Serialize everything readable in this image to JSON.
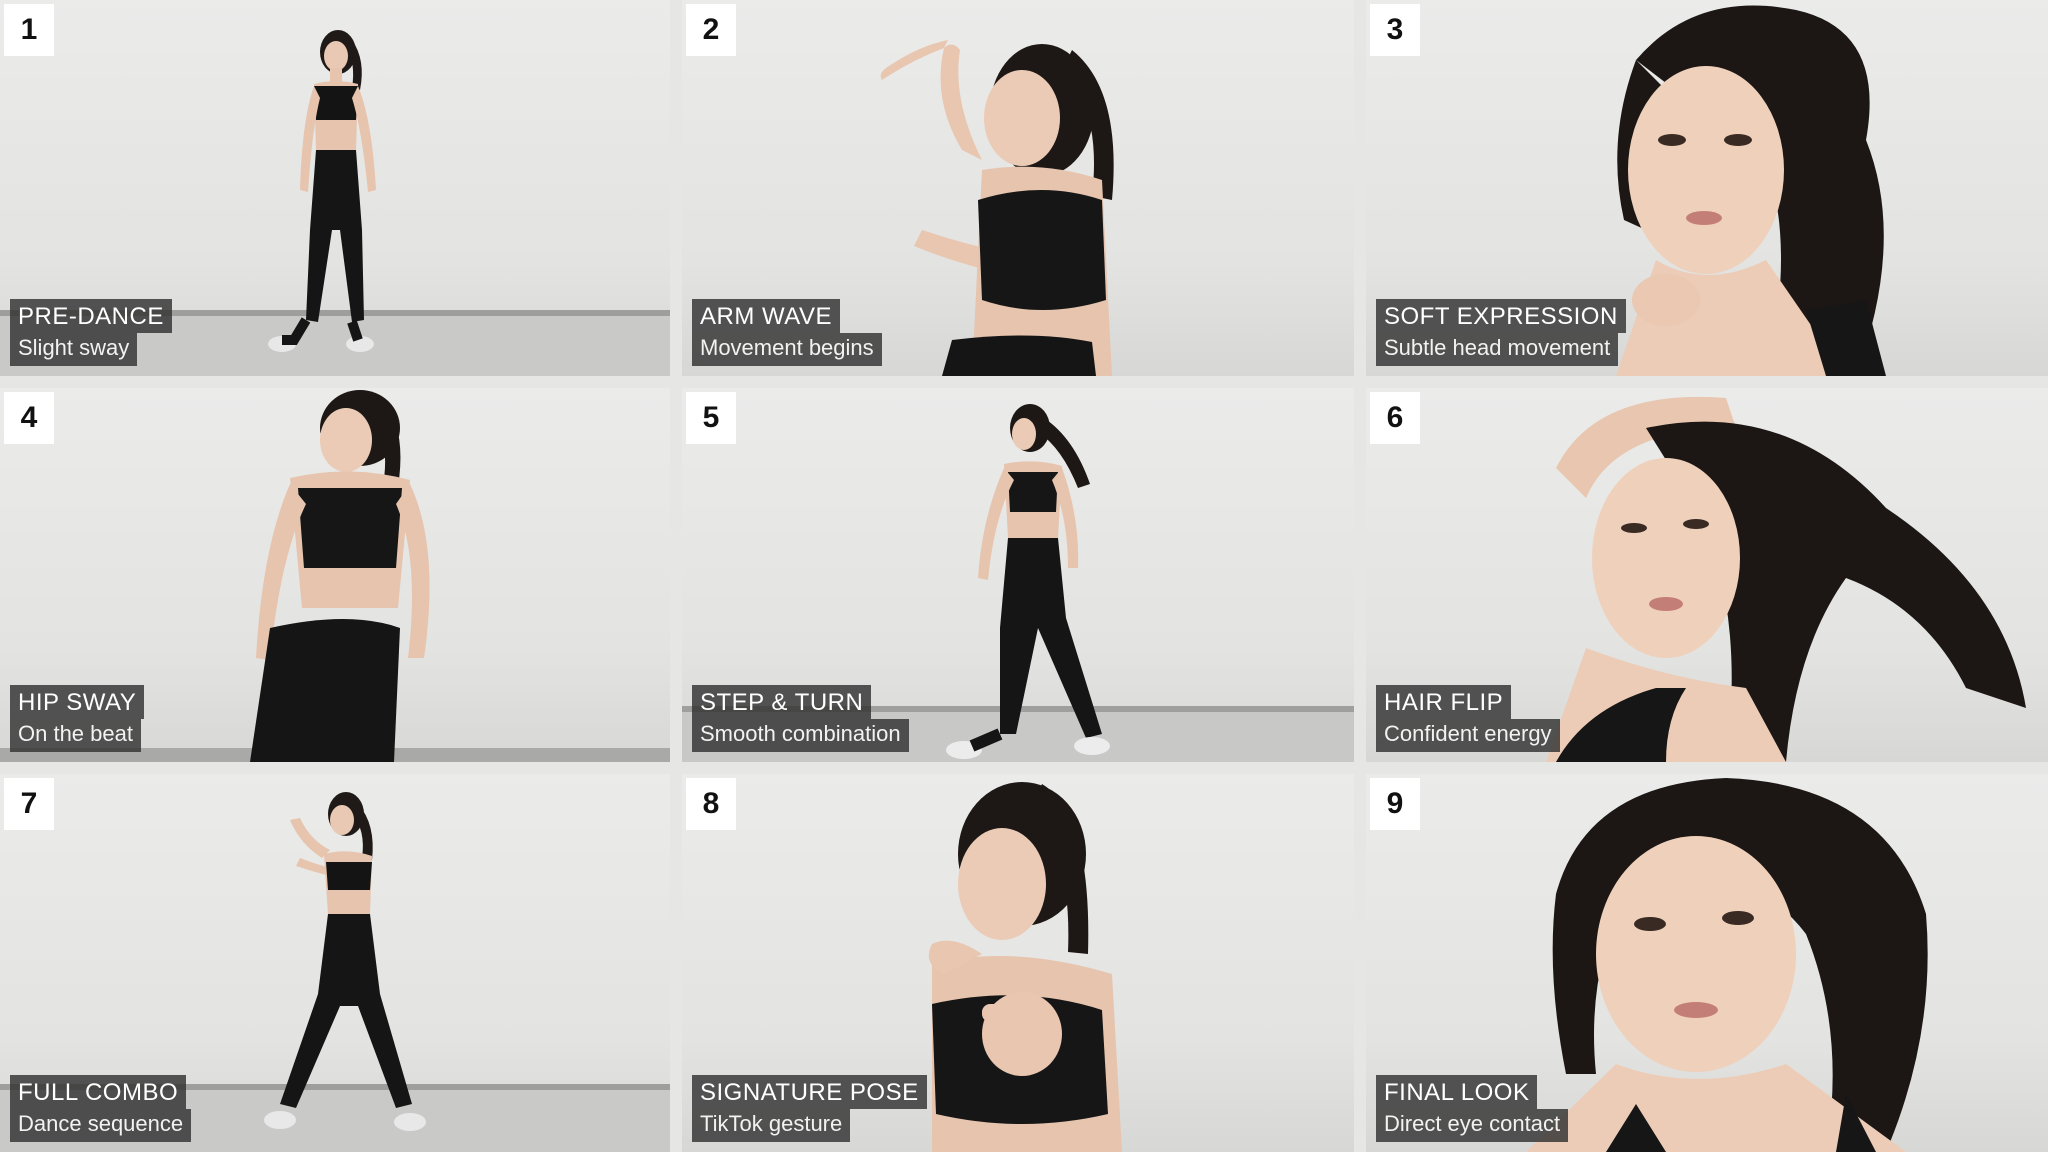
{
  "panels": [
    {
      "number": "1",
      "title": "PRE-DANCE",
      "subtitle": "Slight sway"
    },
    {
      "number": "2",
      "title": "ARM WAVE",
      "subtitle": "Movement begins"
    },
    {
      "number": "3",
      "title": "SOFT EXPRESSION",
      "subtitle": "Subtle head movement"
    },
    {
      "number": "4",
      "title": "HIP SWAY",
      "subtitle": "On the beat"
    },
    {
      "number": "5",
      "title": "STEP & TURN",
      "subtitle": "Smooth combination"
    },
    {
      "number": "6",
      "title": "HAIR FLIP",
      "subtitle": "Confident energy"
    },
    {
      "number": "7",
      "title": "FULL COMBO",
      "subtitle": "Dance sequence"
    },
    {
      "number": "8",
      "title": "SIGNATURE POSE",
      "subtitle": "TikTok gesture"
    },
    {
      "number": "9",
      "title": "FINAL LOOK",
      "subtitle": "Direct eye contact"
    }
  ]
}
